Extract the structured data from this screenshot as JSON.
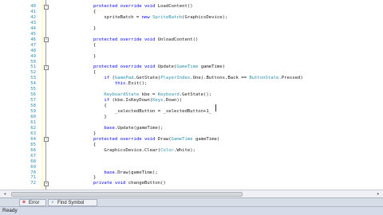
{
  "code_lines": [
    {
      "ln": "40",
      "fold": "⊟",
      "parts": [
        {
          "t": "        "
        },
        {
          "t": "protected override void",
          "c": "kw"
        },
        {
          "t": " LoadContent()"
        }
      ]
    },
    {
      "ln": "41",
      "parts": [
        {
          "t": "        {"
        }
      ]
    },
    {
      "ln": "42",
      "parts": [
        {
          "t": "            spriteBatch = "
        },
        {
          "t": "new",
          "c": "kw"
        },
        {
          "t": " "
        },
        {
          "t": "SpriteBatch",
          "c": "ty"
        },
        {
          "t": "(GraphicsDevice);"
        }
      ]
    },
    {
      "ln": "43",
      "parts": [
        {
          "t": ""
        }
      ]
    },
    {
      "ln": "44",
      "parts": [
        {
          "t": "        }"
        }
      ]
    },
    {
      "ln": "45",
      "parts": [
        {
          "t": ""
        }
      ]
    },
    {
      "ln": "46",
      "fold": "⊟",
      "parts": [
        {
          "t": "        "
        },
        {
          "t": "protected override void",
          "c": "kw"
        },
        {
          "t": " UnloadContent()"
        }
      ]
    },
    {
      "ln": "47",
      "parts": [
        {
          "t": "        {"
        }
      ]
    },
    {
      "ln": "48",
      "parts": [
        {
          "t": ""
        }
      ]
    },
    {
      "ln": "49",
      "parts": [
        {
          "t": "        }"
        }
      ]
    },
    {
      "ln": "50",
      "parts": [
        {
          "t": ""
        }
      ]
    },
    {
      "ln": "51",
      "fold": "⊟",
      "parts": [
        {
          "t": "        "
        },
        {
          "t": "protected override void",
          "c": "kw"
        },
        {
          "t": " Update("
        },
        {
          "t": "GameTime",
          "c": "ty"
        },
        {
          "t": " gameTime)"
        }
      ]
    },
    {
      "ln": "52",
      "parts": [
        {
          "t": "        {"
        }
      ]
    },
    {
      "ln": "53",
      "parts": [
        {
          "t": "            "
        },
        {
          "t": "if",
          "c": "kw"
        },
        {
          "t": " ("
        },
        {
          "t": "GamePad",
          "c": "ty"
        },
        {
          "t": ".GetState("
        },
        {
          "t": "PlayerIndex",
          "c": "ty"
        },
        {
          "t": ".One).Buttons.Back == "
        },
        {
          "t": "ButtonState",
          "c": "ty"
        },
        {
          "t": ".Pressed)"
        }
      ]
    },
    {
      "ln": "54",
      "parts": [
        {
          "t": "                "
        },
        {
          "t": "this",
          "c": "kw"
        },
        {
          "t": ".Exit();"
        }
      ]
    },
    {
      "ln": "55",
      "parts": [
        {
          "t": ""
        }
      ]
    },
    {
      "ln": "56",
      "parts": [
        {
          "t": "            "
        },
        {
          "t": "KeyboardState",
          "c": "ty"
        },
        {
          "t": " kbe = "
        },
        {
          "t": "Keyboard",
          "c": "ty"
        },
        {
          "t": ".GetState();"
        }
      ]
    },
    {
      "ln": "57",
      "parts": [
        {
          "t": "            "
        },
        {
          "t": "if",
          "c": "kw"
        },
        {
          "t": " (kbe.IsKeyDown("
        },
        {
          "t": "Keys",
          "c": "ty"
        },
        {
          "t": ".Down))"
        }
      ]
    },
    {
      "ln": "58",
      "parts": [
        {
          "t": "            {"
        }
      ]
    },
    {
      "ln": "59",
      "parts": [
        {
          "t": "                _selectedButton = _selectedButton+1_"
        }
      ]
    },
    {
      "ln": "60",
      "parts": [
        {
          "t": "            }"
        }
      ]
    },
    {
      "ln": "61",
      "parts": [
        {
          "t": ""
        }
      ]
    },
    {
      "ln": "62",
      "parts": [
        {
          "t": "            "
        },
        {
          "t": "base",
          "c": "kw"
        },
        {
          "t": ".Update(gameTime);"
        }
      ]
    },
    {
      "ln": "63",
      "parts": [
        {
          "t": "        }"
        }
      ]
    },
    {
      "ln": "64",
      "fold": "⊟",
      "parts": [
        {
          "t": "        "
        },
        {
          "t": "protected override void",
          "c": "kw"
        },
        {
          "t": " Draw("
        },
        {
          "t": "GameTime",
          "c": "ty"
        },
        {
          "t": " gameTime)"
        }
      ]
    },
    {
      "ln": "65",
      "parts": [
        {
          "t": "        {"
        }
      ]
    },
    {
      "ln": "66",
      "parts": [
        {
          "t": "            GraphicsDevice.Clear("
        },
        {
          "t": "Color",
          "c": "ty"
        },
        {
          "t": ".White);"
        }
      ]
    },
    {
      "ln": "67",
      "parts": [
        {
          "t": ""
        }
      ]
    },
    {
      "ln": "68",
      "parts": [
        {
          "t": ""
        }
      ]
    },
    {
      "ln": "69",
      "parts": [
        {
          "t": ""
        }
      ]
    },
    {
      "ln": "70",
      "parts": [
        {
          "t": "            "
        },
        {
          "t": "base",
          "c": "kw"
        },
        {
          "t": ".Draw(gameTime);"
        }
      ]
    },
    {
      "ln": "71",
      "parts": [
        {
          "t": "        }"
        }
      ]
    },
    {
      "ln": "72",
      "fold": "⊟",
      "parts": [
        {
          "t": "        "
        },
        {
          "t": "private void",
          "c": "kw"
        },
        {
          "t": " changeButton()"
        }
      ]
    }
  ],
  "bottom_tabs": [
    {
      "label": "Error List",
      "icon": "⊗"
    },
    {
      "label": "Find Symbol Results",
      "icon": "⌕"
    }
  ],
  "status_text": "Ready",
  "colors": {
    "keyword": "#0000ff",
    "type": "#2b91af",
    "line_number": "#2b91af"
  }
}
